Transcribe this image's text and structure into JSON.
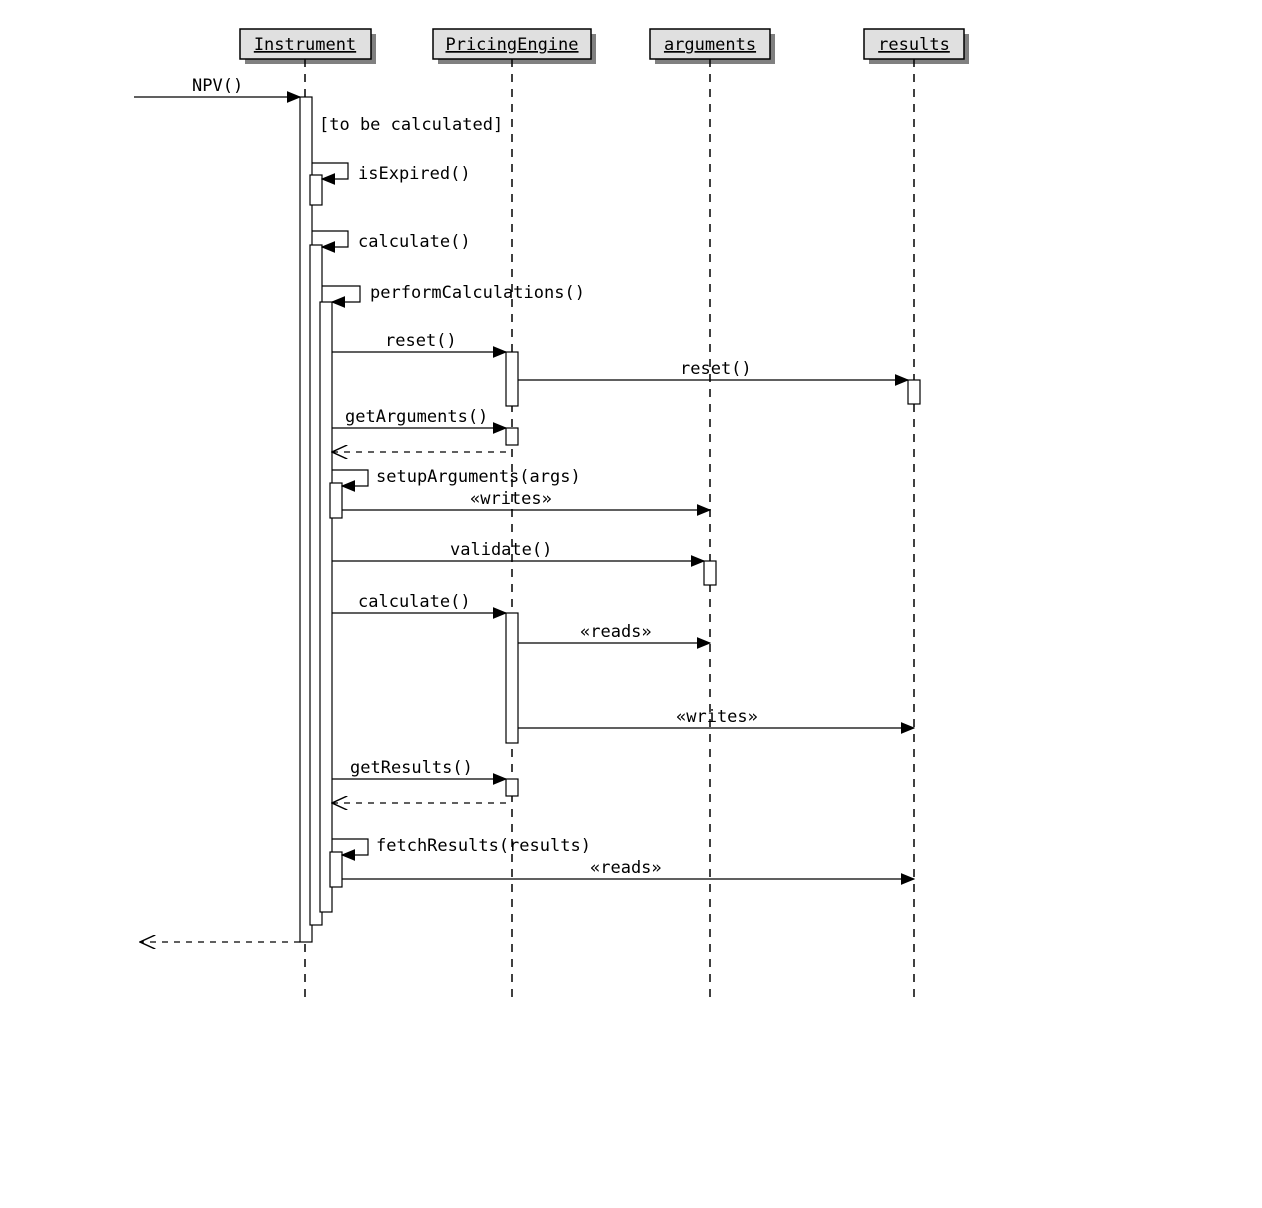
{
  "participants": {
    "instrument": "Instrument",
    "pricing_engine": "PricingEngine",
    "arguments": "arguments",
    "results": "results"
  },
  "messages": {
    "npv": "NPV()",
    "guard": "[to be calculated]",
    "is_expired": "isExpired()",
    "calculate": "calculate()",
    "perform_calculations": "performCalculations()",
    "reset": "reset()",
    "reset2": "reset()",
    "get_arguments": "getArguments()",
    "setup_arguments": "setupArguments(args)",
    "writes": "«writes»",
    "validate": "validate()",
    "calculate2": "calculate()",
    "reads": "«reads»",
    "writes2": "«writes»",
    "get_results": "getResults()",
    "fetch_results": "fetchResults(results)",
    "reads2": "«reads»"
  }
}
